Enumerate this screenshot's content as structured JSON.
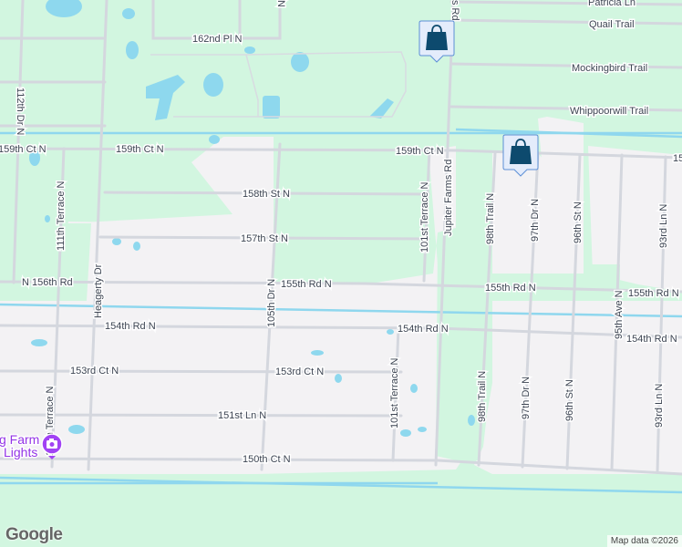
{
  "map": {
    "colors": {
      "park": "#d2f6e0",
      "residential": "#f3f2f4",
      "road": "#d4d7de",
      "water": "#8ed8ee",
      "pin": "#0d4a6e",
      "poi": "#9334e6"
    },
    "streets": {
      "patricia_ln": "Patricia Ln",
      "quail_trail": "Quail Trail",
      "mockingbird_trail": "Mockingbird Trail",
      "whippoorwill_trail": "Whippoorwill Trail",
      "pl162": "162nd Pl N",
      "ct159_left": "159th Ct N",
      "ct159_mid": "159th Ct N",
      "ct159_right": "159th Ct N",
      "ct159_edge": "15",
      "st158": "158th St N",
      "st157": "157th St N",
      "rd156": "N 156th Rd",
      "rd155_a": "155th Rd N",
      "rd155_b": "155th Rd N",
      "rd155_c": "155th Rd N",
      "rd154_a": "154th Rd N",
      "rd154_b": "154th Rd N",
      "rd154_c": "154th Rd N",
      "ct153_a": "153rd Ct N",
      "ct153_b": "153rd Ct N",
      "ln151": "151st Ln N",
      "ct150": "150th Ct N",
      "dr112": "112th Dr N",
      "ter111_top": "111th Terrace N",
      "ter111_bot": "111th Terrace N",
      "heagerty": "Heagerty Dr",
      "dr105": "105th Dr N",
      "ter101_top": "101st Terrace N",
      "ter101_bot": "101st Terrace N",
      "jupiter": "Jupiter Farms Rd",
      "jupiter_top": "s Rd",
      "trail98_top": "98th Trail N",
      "trail98_bot": "98th Trail N",
      "dr97_top": "97th Dr N",
      "dr97_bot": "97th Dr N",
      "st96_top": "96th St N",
      "st96_bot": "96th St N",
      "ave95": "95th Ave N",
      "ln93_top": "93rd Ln N",
      "ln93_bot": "93rd Ln N",
      "n_top": "N"
    },
    "markers": [
      {
        "type": "shopping",
        "icon": "shopping-bag-icon"
      },
      {
        "type": "shopping",
        "icon": "shopping-bag-icon"
      }
    ],
    "poi": {
      "line1": "g Farm",
      "line2": "Lights",
      "icon": "camera-icon"
    },
    "logo": "Google",
    "attribution": "Map data ©2026"
  }
}
